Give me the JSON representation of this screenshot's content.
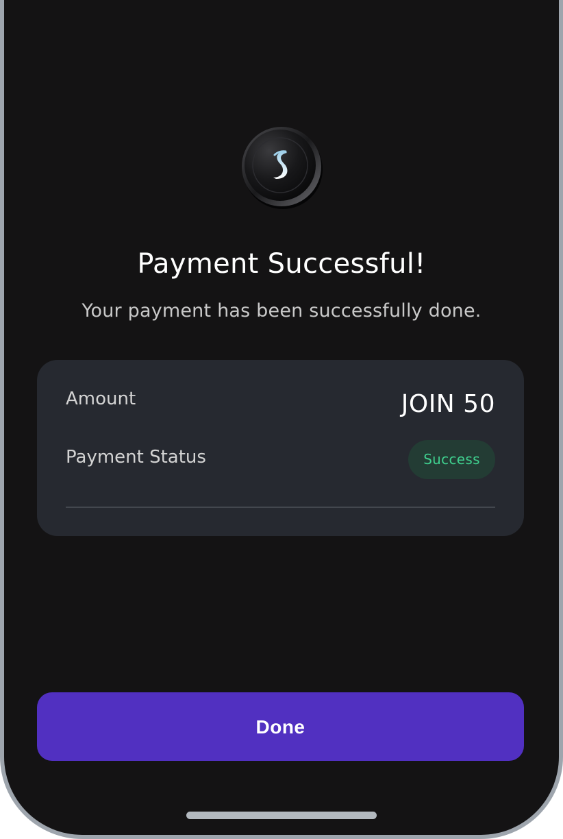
{
  "header": {
    "logo_icon": "coin-logo-icon"
  },
  "message": {
    "title": "Payment Successful!",
    "subtitle": "Your payment has been successfully done."
  },
  "details": {
    "amount_label": "Amount",
    "amount_value": "JOIN 50",
    "status_label": "Payment Status",
    "status_value": "Success"
  },
  "actions": {
    "done_label": "Done"
  },
  "colors": {
    "background": "#141314",
    "card": "#262930",
    "accent": "#5130c1",
    "success_text": "#3fcf8e",
    "success_badge": "#233c34"
  }
}
